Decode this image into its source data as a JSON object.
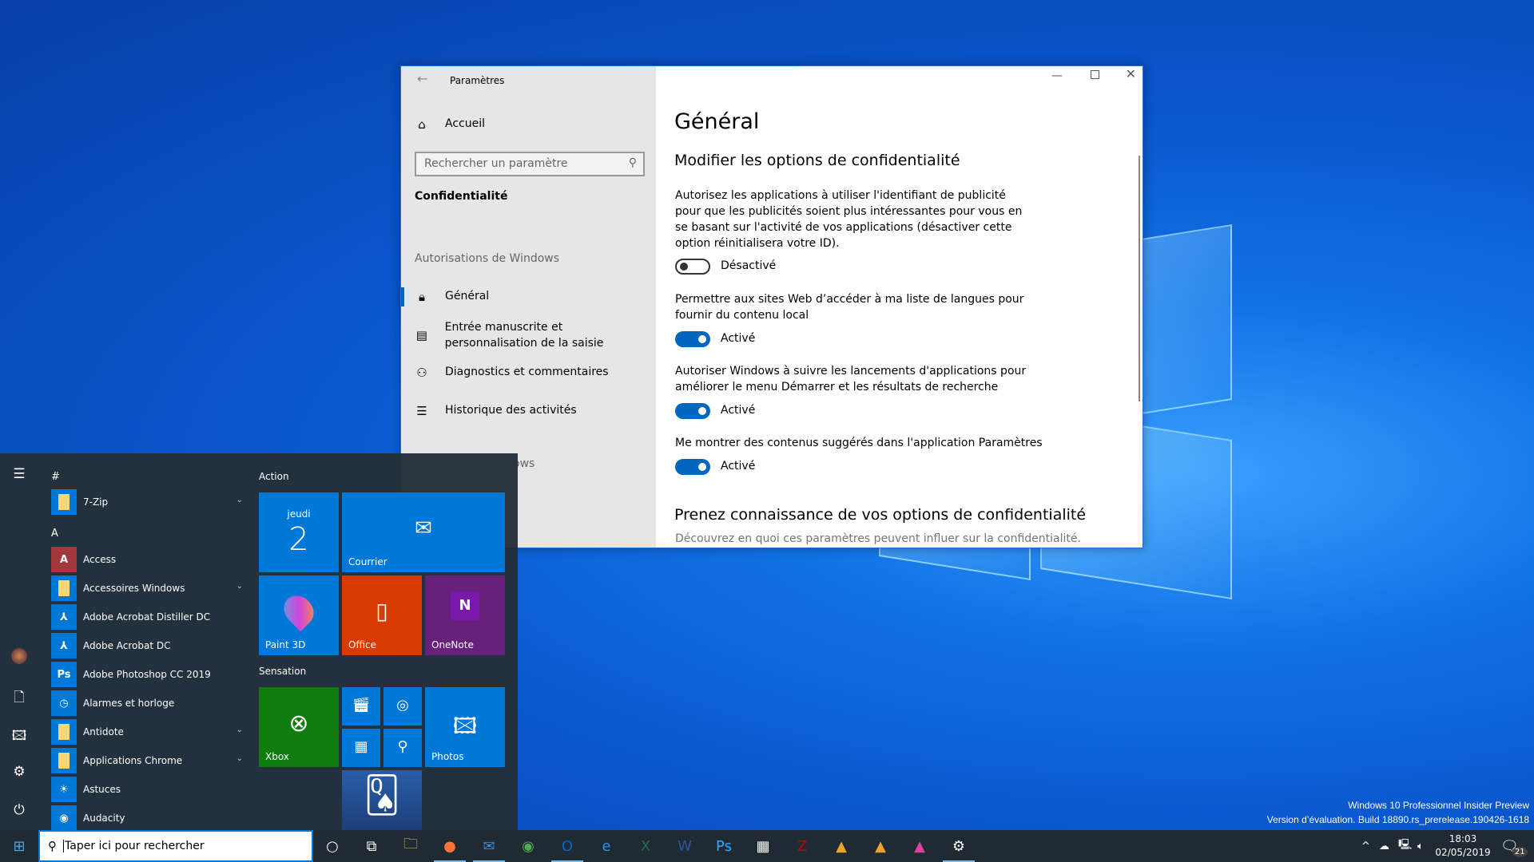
{
  "desktop": {
    "watermark_line1": "Windows 10 Professionnel Insider Preview",
    "watermark_line2": "Version d’évaluation. Build 18890.rs_prerelease.190426-1618"
  },
  "settings": {
    "title": "Paramètres",
    "home": "Accueil",
    "search_placeholder": "Rechercher un paramètre",
    "category": "Confidentialité",
    "section": "Autorisations de Windows",
    "nav": [
      {
        "label": "Général",
        "icon": "lock-icon",
        "selected": true
      },
      {
        "label": "Entrée manuscrite et personnalisation de la saisie",
        "icon": "clipboard-icon"
      },
      {
        "label": "Diagnostics et commentaires",
        "icon": "feedback-icon"
      },
      {
        "label": "Historique des activités",
        "icon": "timeline-icon"
      }
    ],
    "hidden_fragment": "ows",
    "page_title": "Général",
    "heading": "Modifier les options de confidentialité",
    "options": [
      {
        "text": "Autorisez les applications à utiliser l'identifiant de publicité pour que les publicités soient plus intéressantes pour vous en se basant sur l'activité de vos applications (désactiver cette option réinitialisera votre ID).",
        "state": "Désactivé",
        "on": false
      },
      {
        "text": "Permettre aux sites Web d’accéder à ma liste de langues pour fournir du contenu local",
        "state": "Activé",
        "on": true
      },
      {
        "text": "Autoriser Windows à suivre les lancements d'applications pour améliorer le menu Démarrer et les résultats de recherche",
        "state": "Activé",
        "on": true
      },
      {
        "text": "Me montrer des contenus suggérés dans l'application Paramètres",
        "state": "Activé",
        "on": true
      }
    ],
    "heading2": "Prenez connaissance de vos options de confidentialité",
    "subtext": "Découvrez en quoi ces paramètres peuvent influer sur la confidentialité.",
    "accent": "#0067c0"
  },
  "start": {
    "letters": [
      "#",
      "A"
    ],
    "apps": [
      {
        "label": "7-Zip",
        "folder": true
      },
      {
        "label": "Access",
        "icon": "A",
        "color": "#a4373a"
      },
      {
        "label": "Accessoires Windows",
        "folder": true
      },
      {
        "label": "Adobe Acrobat Distiller DC",
        "icon": "⅄",
        "color": "#0078d7"
      },
      {
        "label": "Adobe Acrobat DC",
        "icon": "⅄",
        "color": "#0078d7"
      },
      {
        "label": "Adobe Photoshop CC 2019",
        "icon": "Ps",
        "color": "#0078d7"
      },
      {
        "label": "Alarmes et horloge",
        "icon": "◷",
        "color": "#0078d7"
      },
      {
        "label": "Antidote",
        "folder": true
      },
      {
        "label": "Applications Chrome",
        "folder": true
      },
      {
        "label": "Astuces",
        "icon": "☀",
        "color": "#0078d7"
      },
      {
        "label": "Audacity",
        "icon": "◉",
        "color": "#0078d7"
      }
    ],
    "groups": [
      "Action",
      "Sensation"
    ],
    "tiles": {
      "calendar_day": "jeudi",
      "calendar_date": "2",
      "mail": "Courrier",
      "paint3d": "Paint 3D",
      "office": "Office",
      "onenote": "OneNote",
      "xbox": "Xbox",
      "photos": "Photos"
    }
  },
  "taskbar": {
    "search_placeholder": "Taper ici pour rechercher",
    "time": "18:03",
    "date": "02/05/2019",
    "notifications": "21",
    "apps": [
      "cortana",
      "task-view",
      "file-explorer",
      "firefox",
      "thunderbird",
      "chrome",
      "outlook",
      "edge",
      "excel",
      "word",
      "photoshop",
      "calculator",
      "filezilla",
      "steem",
      "steem",
      "disk",
      "settings"
    ]
  }
}
